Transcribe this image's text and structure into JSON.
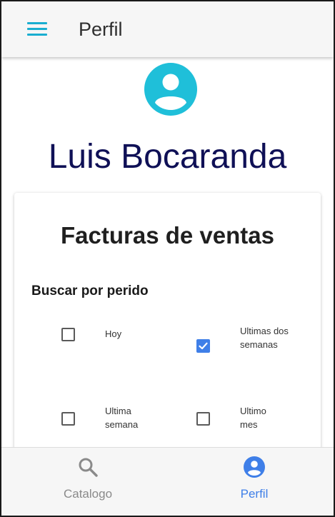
{
  "app_bar": {
    "title": "Perfil",
    "menu_icon": "hamburger-menu-icon"
  },
  "profile": {
    "avatar_icon": "account-circle-icon",
    "name": "Luis Bocaranda"
  },
  "card": {
    "title": "Facturas de ventas",
    "filter_label": "Buscar por perido",
    "options": [
      {
        "label": "Hoy",
        "checked": false
      },
      {
        "label": "Ultimas dos semanas",
        "checked": true
      },
      {
        "label": "Ultima semana",
        "checked": false
      },
      {
        "label": "Ultimo mes",
        "checked": false
      }
    ]
  },
  "bottom_nav": {
    "items": [
      {
        "label": "Catalogo",
        "icon": "search-icon",
        "active": false
      },
      {
        "label": "Perfil",
        "icon": "account-circle-icon",
        "active": true
      }
    ]
  },
  "colors": {
    "accent": "#1aaed0",
    "nav_active": "#3f7fe8",
    "nav_inactive": "#8a8a8a",
    "name_text": "#0f1056",
    "checkbox_checked": "#3f7fe8"
  }
}
